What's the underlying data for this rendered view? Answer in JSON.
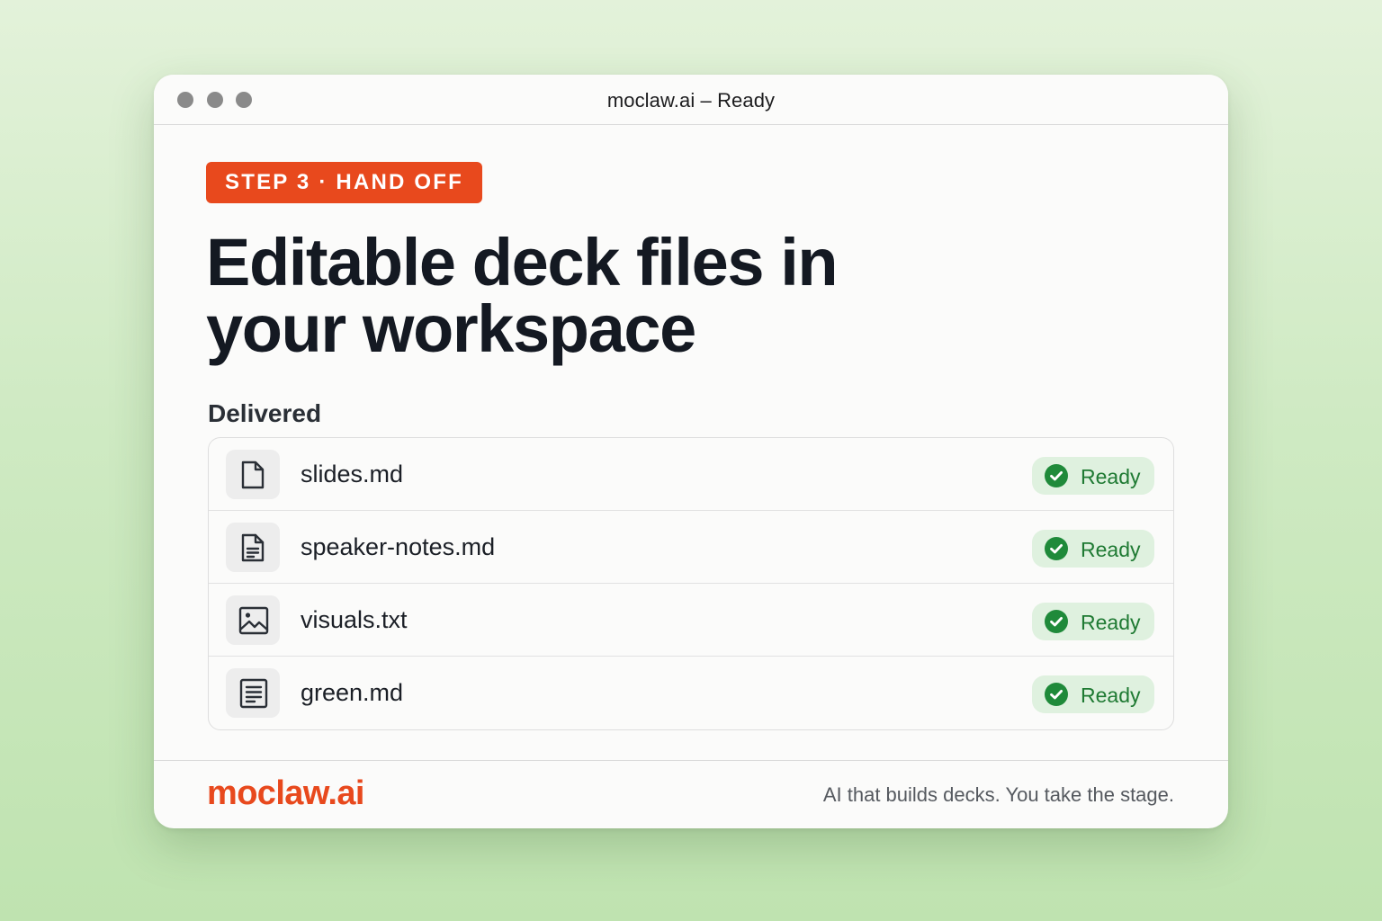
{
  "window": {
    "title": "moclaw.ai – Ready"
  },
  "step_badge": "STEP 3 · HAND OFF",
  "headline": {
    "line1": "Editable deck files in",
    "line2": "your workspace"
  },
  "section_label": "Delivered",
  "files": [
    {
      "name": "slides.md",
      "icon": "file-icon",
      "status": "Ready"
    },
    {
      "name": "speaker-notes.md",
      "icon": "file-text-icon",
      "status": "Ready"
    },
    {
      "name": "visuals.txt",
      "icon": "image-icon",
      "status": "Ready"
    },
    {
      "name": "green.md",
      "icon": "document-lines-icon",
      "status": "Ready"
    }
  ],
  "footer": {
    "brand": "moclaw.ai",
    "tagline": "AI that builds decks. You take the stage."
  },
  "colors": {
    "accent": "#e8491d",
    "ready_green": "#1f8a3a",
    "ready_bg": "#dff1df"
  }
}
